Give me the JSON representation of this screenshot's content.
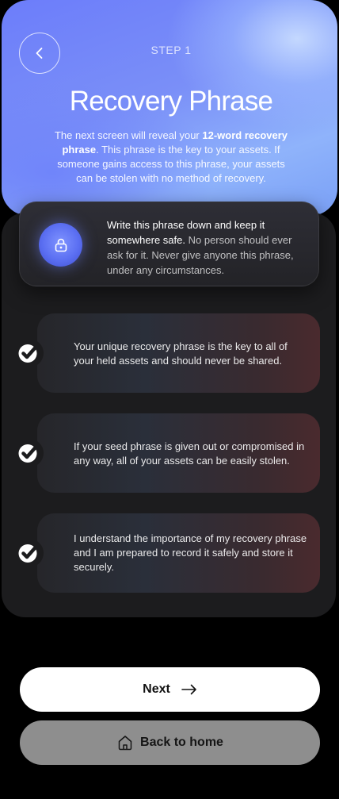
{
  "header": {
    "step_label": "STEP 1",
    "title": "Recovery Phrase",
    "intro_pre": "The next screen will reveal your ",
    "intro_bold": "12-word recovery phrase",
    "intro_post": ". This phrase is the key to your assets. If someone gains access to this phrase, your assets can be stolen with no method of recovery."
  },
  "warning": {
    "icon": "lock-icon",
    "strong": "Write this phrase down and keep it somewhere safe.",
    "rest": " No person should ever ask for it. Never give anyone this phrase, under any circumstances."
  },
  "checklist": [
    {
      "icon": "checkmark-icon",
      "text": "Your unique recovery phrase is the key to all of your held assets and should never be shared."
    },
    {
      "icon": "checkmark-icon",
      "text": "If your seed phrase is given out or compromised in any way, all of your assets can be easily stolen."
    },
    {
      "icon": "checkmark-icon",
      "text": "I understand the importance of my recovery phrase and I am prepared to record it safely and store it securely."
    }
  ],
  "buttons": {
    "next_label": "Next",
    "home_label": "Back to home"
  },
  "colors": {
    "accent_blue": "#6c7dfa",
    "panel_bg": "#1c1c1e",
    "primary_button": "#ffffff",
    "secondary_button": "#8e8e8e"
  }
}
